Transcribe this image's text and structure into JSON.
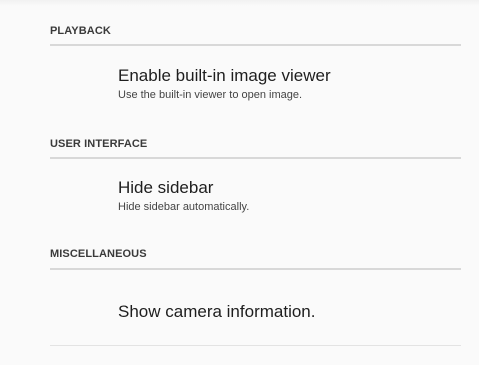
{
  "sections": {
    "playback": {
      "header": "PLAYBACK",
      "items": [
        {
          "title": "Enable built-in image viewer",
          "summary": "Use the built-in viewer to open image."
        }
      ]
    },
    "user_interface": {
      "header": "USER INTERFACE",
      "items": [
        {
          "title": "Hide sidebar",
          "summary": "Hide sidebar automatically."
        }
      ]
    },
    "miscellaneous": {
      "header": "MISCELLANEOUS",
      "items": [
        {
          "title": "Show camera information."
        }
      ]
    }
  }
}
